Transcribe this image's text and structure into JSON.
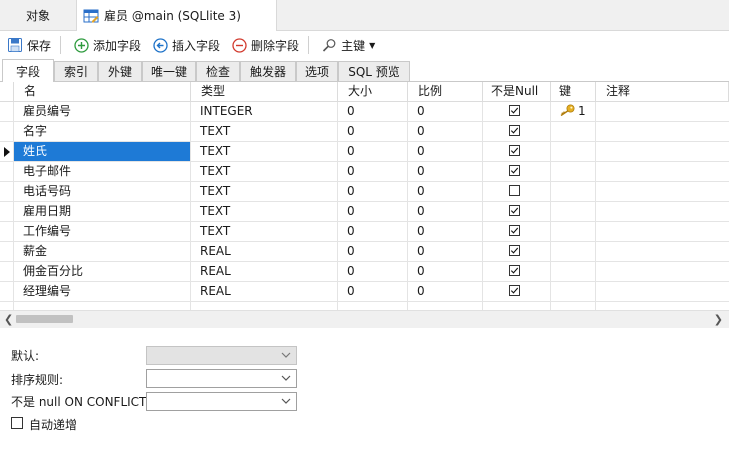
{
  "tabs": {
    "objects": "对象",
    "table_tab": "雇员 @main (SQLlite 3)"
  },
  "toolbar": {
    "save": "保存",
    "add_field": "添加字段",
    "insert_field": "插入字段",
    "delete_field": "删除字段",
    "primary_key": "主键"
  },
  "subtabs": [
    "字段",
    "索引",
    "外键",
    "唯一键",
    "检查",
    "触发器",
    "选项",
    "SQL 预览"
  ],
  "columns": [
    "名",
    "类型",
    "大小",
    "比例",
    "不是Null",
    "键",
    "注释"
  ],
  "rows": [
    {
      "name": "雇员编号",
      "type": "INTEGER",
      "size": "0",
      "scale": "0",
      "not_null": true,
      "key": "1"
    },
    {
      "name": "名字",
      "type": "TEXT",
      "size": "0",
      "scale": "0",
      "not_null": true,
      "key": ""
    },
    {
      "name": "姓氏",
      "type": "TEXT",
      "size": "0",
      "scale": "0",
      "not_null": true,
      "key": ""
    },
    {
      "name": "电子邮件",
      "type": "TEXT",
      "size": "0",
      "scale": "0",
      "not_null": true,
      "key": ""
    },
    {
      "name": "电话号码",
      "type": "TEXT",
      "size": "0",
      "scale": "0",
      "not_null": false,
      "key": ""
    },
    {
      "name": "雇用日期",
      "type": "TEXT",
      "size": "0",
      "scale": "0",
      "not_null": true,
      "key": ""
    },
    {
      "name": "工作编号",
      "type": "TEXT",
      "size": "0",
      "scale": "0",
      "not_null": true,
      "key": ""
    },
    {
      "name": "薪金",
      "type": "REAL",
      "size": "0",
      "scale": "0",
      "not_null": true,
      "key": ""
    },
    {
      "name": "佣金百分比",
      "type": "REAL",
      "size": "0",
      "scale": "0",
      "not_null": true,
      "key": ""
    },
    {
      "name": "经理编号",
      "type": "REAL",
      "size": "0",
      "scale": "0",
      "not_null": true,
      "key": ""
    }
  ],
  "selected_row": 2,
  "props": {
    "default_label": "默认:",
    "collation_label": "排序规则:",
    "not_null_conflict_label": "不是 null ON CONFLICT:",
    "autoincrement_label": "自动递增"
  },
  "colors": {
    "selection": "#1e7ad6",
    "add_icon": "#2e9b3e",
    "insert_icon": "#1e72c8",
    "delete_icon": "#d23a2e",
    "key_icon": "#d9a21b"
  }
}
